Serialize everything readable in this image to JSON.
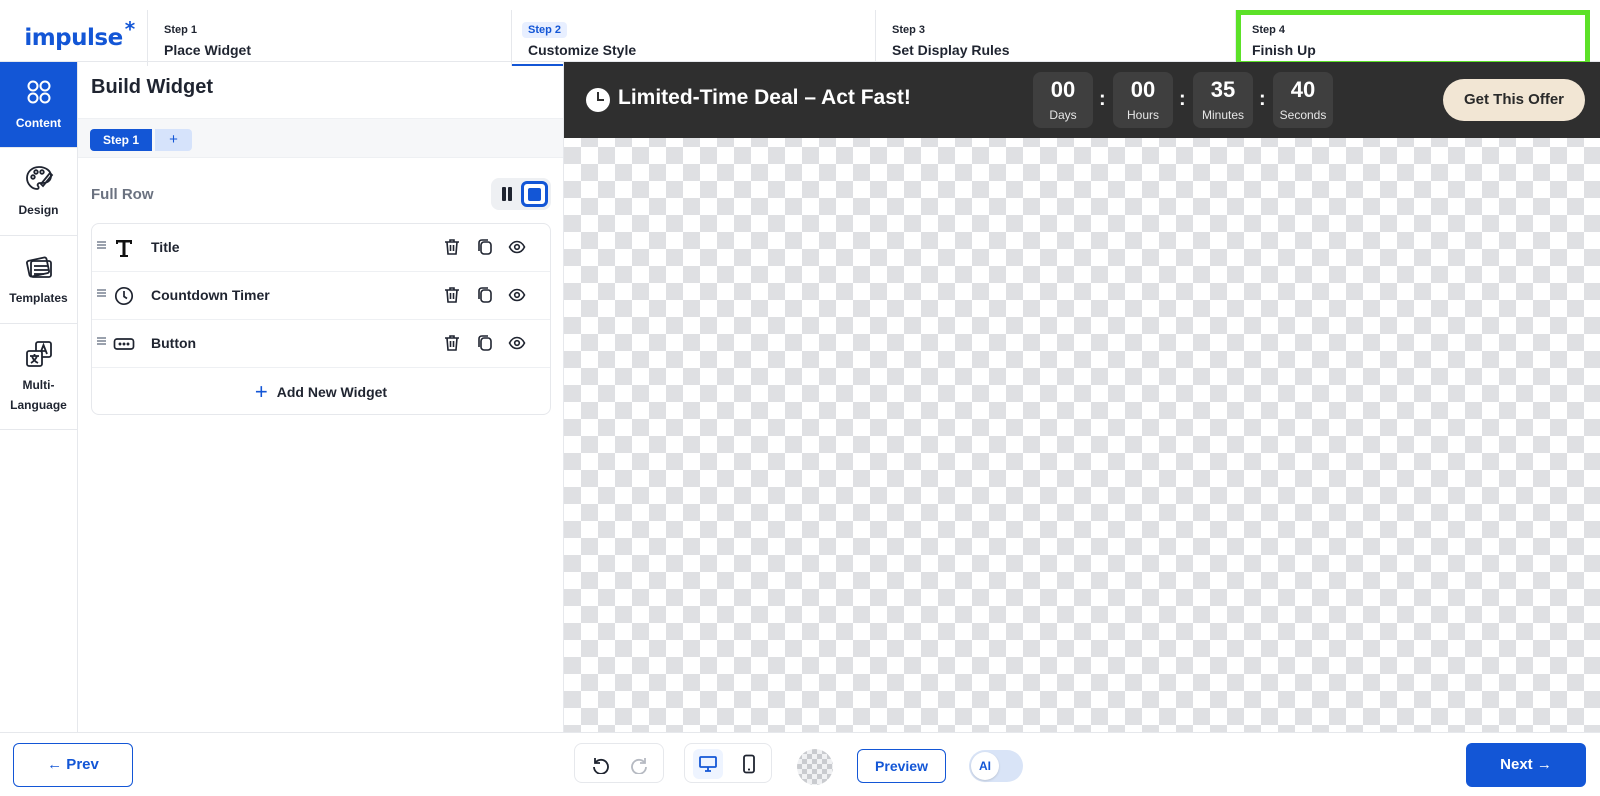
{
  "brand": {
    "logo_text": "impulse",
    "logo_mark": "*",
    "color": "#1356d6"
  },
  "stepper": [
    {
      "num": "Step 1",
      "title": "Place Widget"
    },
    {
      "num": "Step 2",
      "title": "Customize Style"
    },
    {
      "num": "Step 3",
      "title": "Set Display Rules"
    },
    {
      "num": "Step 4",
      "title": "Finish Up"
    }
  ],
  "leftnav": [
    {
      "label": "Content",
      "icon": "grid-icon",
      "active": true
    },
    {
      "label": "Design",
      "icon": "palette-icon"
    },
    {
      "label": "Templates",
      "icon": "templates-icon"
    },
    {
      "label": "Multi-\nLanguage",
      "icon": "translate-icon"
    }
  ],
  "panel": {
    "title": "Build Widget",
    "step_tab": "Step 1",
    "step_add": "+",
    "row_label": "Full Row",
    "widgets": [
      {
        "label": "Title",
        "icon": "text-icon"
      },
      {
        "label": "Countdown Timer",
        "icon": "clock-icon"
      },
      {
        "label": "Button",
        "icon": "button-icon"
      }
    ],
    "add_widget": "Add New Widget"
  },
  "preview": {
    "deal_title": "Limited-Time Deal – Act Fast!",
    "timer": [
      {
        "value": "00",
        "label": "Days"
      },
      {
        "value": "00",
        "label": "Hours"
      },
      {
        "value": "35",
        "label": "Minutes"
      },
      {
        "value": "40",
        "label": "Seconds"
      }
    ],
    "separator": ":",
    "cta": "Get This Offer"
  },
  "bottombar": {
    "prev": "← Prev",
    "preview": "Preview",
    "ai": "AI",
    "next": "Next →"
  },
  "colors": {
    "accent": "#1356d6",
    "highlight": "#5ce128",
    "bar": "#2f2f2f",
    "cta_bg": "#f2e6d4"
  }
}
